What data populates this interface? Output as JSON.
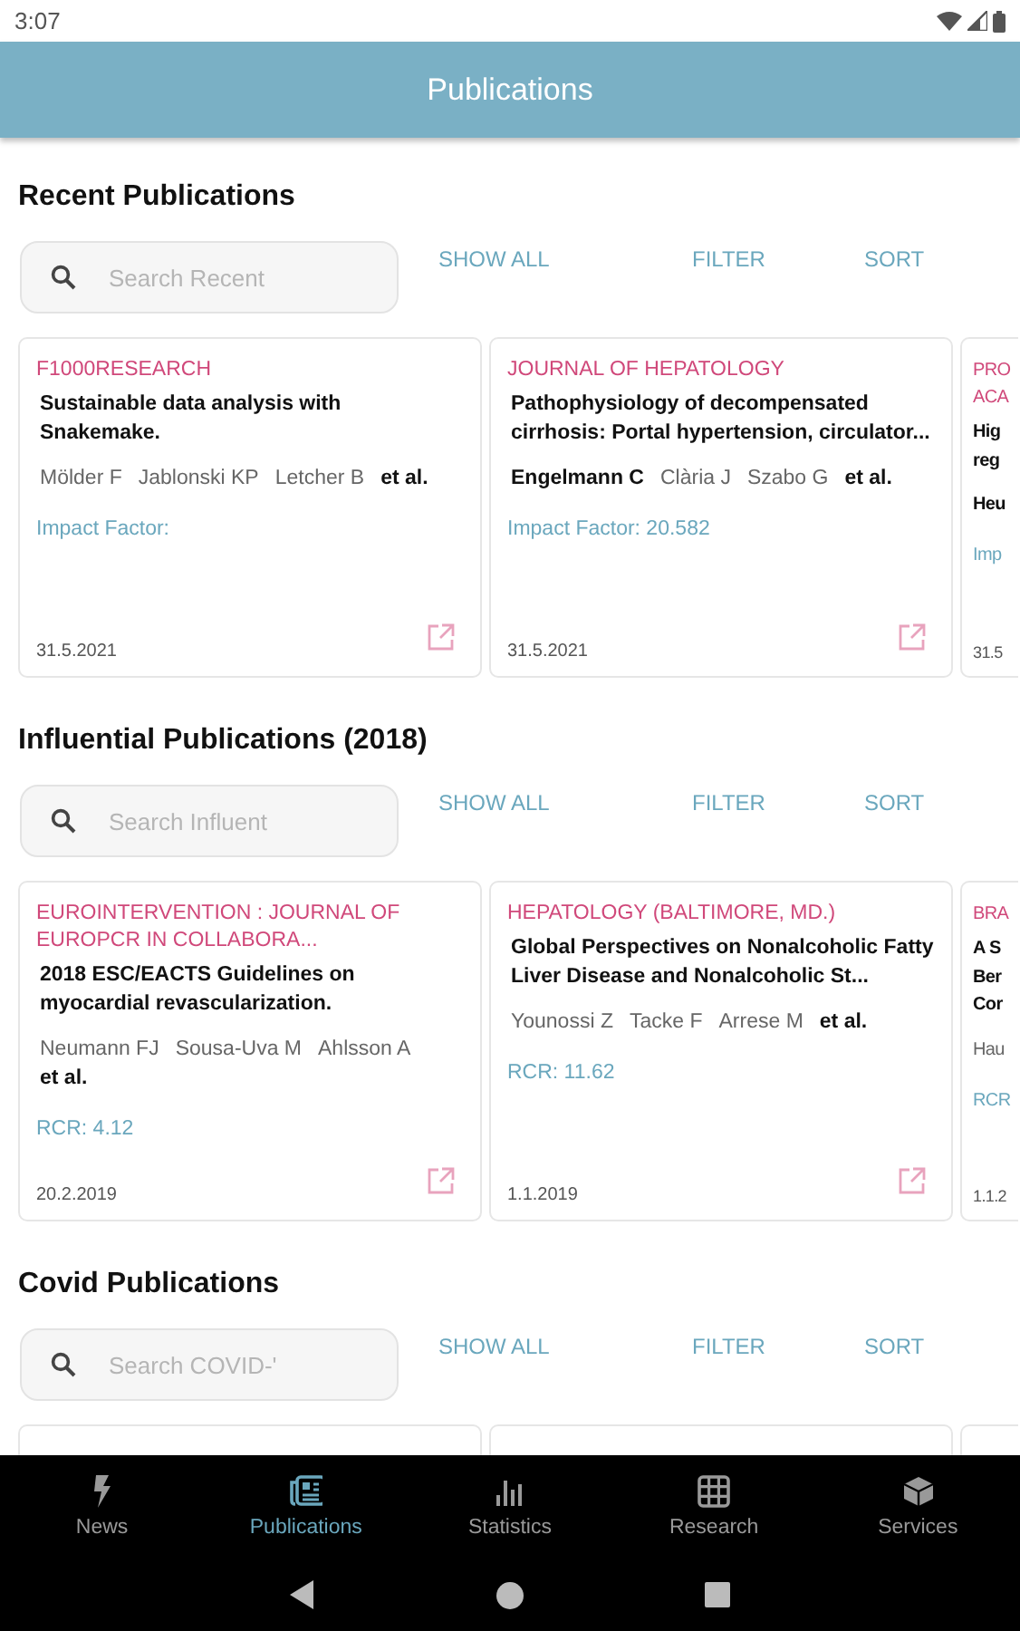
{
  "status_bar": {
    "time": "3:07"
  },
  "app_bar": {
    "title": "Publications"
  },
  "sections": [
    {
      "title": "Recent Publications",
      "search": {
        "placeholder": "Search Recent"
      },
      "actions": [
        "SHOW ALL",
        "FILTER",
        "SORT"
      ],
      "cards": [
        {
          "kind": "card",
          "journal": "F1000RESEARCH",
          "title": "Sustainable data analysis with Snakemake.",
          "authors": [
            {
              "name": "Mölder F",
              "highlighted": false
            },
            {
              "name": "Jablonski KP",
              "highlighted": false
            },
            {
              "name": "Letcher B",
              "highlighted": false
            }
          ],
          "et_al": "et al.",
          "metric": "Impact Factor:",
          "date": "31.5.2021"
        },
        {
          "kind": "card",
          "journal": "JOURNAL OF HEPATOLOGY",
          "title": "Pathophysiology of decompensated cirrhosis: Portal hypertension, circulator...",
          "authors": [
            {
              "name": "Engelmann C",
              "highlighted": true
            },
            {
              "name": "Clària J",
              "highlighted": false
            },
            {
              "name": "Szabo G",
              "highlighted": false
            }
          ],
          "et_al": "et al.",
          "metric": "Impact Factor: 20.582",
          "date": "31.5.2021"
        },
        {
          "kind": "partial",
          "journal": "PRO ACA",
          "title": "Hig reg",
          "authors": [
            {
              "name": "Heu",
              "highlighted": true
            }
          ],
          "metric": "Imp",
          "date": "31.5"
        }
      ]
    },
    {
      "title": "Influential Publications (2018)",
      "search": {
        "placeholder": "Search Influent"
      },
      "actions": [
        "SHOW ALL",
        "FILTER",
        "SORT"
      ],
      "cards": [
        {
          "kind": "card",
          "journal": "EUROINTERVENTION : JOURNAL OF EUROPCR IN COLLABORA...",
          "title": "2018 ESC/EACTS Guidelines on myocardial revascularization.",
          "authors": [
            {
              "name": "Neumann FJ",
              "highlighted": false
            },
            {
              "name": "Sousa-Uva M",
              "highlighted": false
            },
            {
              "name": "Ahlsson A",
              "highlighted": false
            }
          ],
          "et_al": "et al.",
          "metric": "RCR: 4.12",
          "date": "20.2.2019"
        },
        {
          "kind": "card",
          "journal": "HEPATOLOGY (BALTIMORE, MD.)",
          "title": "Global Perspectives on Nonalcoholic Fatty Liver Disease and Nonalcoholic St...",
          "authors": [
            {
              "name": "Younossi Z",
              "highlighted": false
            },
            {
              "name": "Tacke F",
              "highlighted": false
            },
            {
              "name": "Arrese M",
              "highlighted": false
            }
          ],
          "et_al": "et al.",
          "metric": "RCR: 11.62",
          "date": "1.1.2019"
        },
        {
          "kind": "partial",
          "journal": "BRA",
          "title": "A S Ber Cor",
          "authors": [
            {
              "name": "Hau",
              "highlighted": false
            }
          ],
          "metric": "RCR",
          "date": "1.1.2"
        }
      ]
    },
    {
      "title": "Covid Publications",
      "search": {
        "placeholder": "Search COVID-'"
      },
      "actions": [
        "SHOW ALL",
        "FILTER",
        "SORT"
      ],
      "cards": [
        {
          "kind": "card"
        },
        {
          "kind": "card"
        },
        {
          "kind": "partial"
        }
      ]
    }
  ],
  "bottom_nav": [
    {
      "label": "News",
      "selected": false
    },
    {
      "label": "Publications",
      "selected": true
    },
    {
      "label": "Statistics",
      "selected": false
    },
    {
      "label": "Research",
      "selected": false
    },
    {
      "label": "Services",
      "selected": false
    }
  ]
}
